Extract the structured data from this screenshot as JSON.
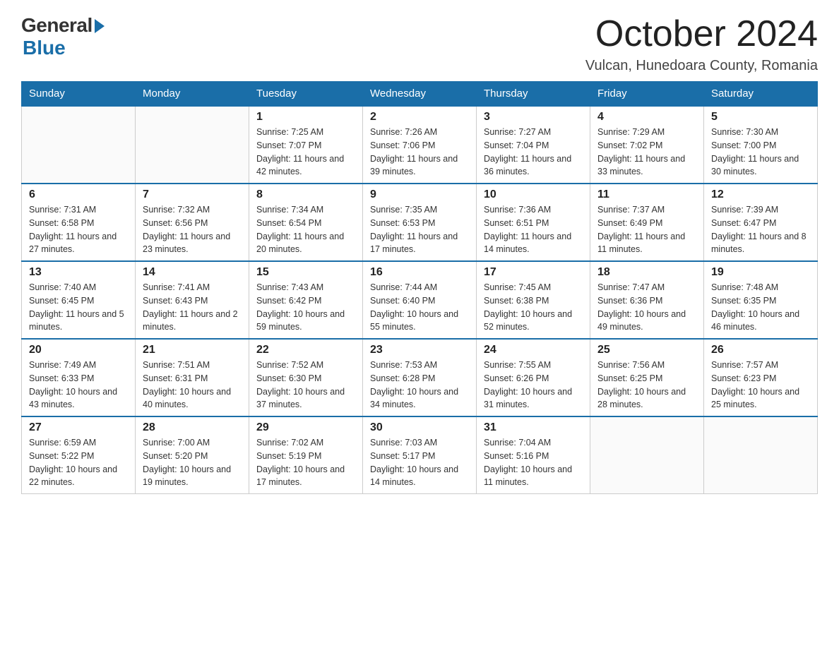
{
  "logo": {
    "general": "General",
    "blue": "Blue"
  },
  "title": "October 2024",
  "location": "Vulcan, Hunedoara County, Romania",
  "days_of_week": [
    "Sunday",
    "Monday",
    "Tuesday",
    "Wednesday",
    "Thursday",
    "Friday",
    "Saturday"
  ],
  "weeks": [
    [
      {
        "day": "",
        "info": ""
      },
      {
        "day": "",
        "info": ""
      },
      {
        "day": "1",
        "info": "Sunrise: 7:25 AM\nSunset: 7:07 PM\nDaylight: 11 hours\nand 42 minutes."
      },
      {
        "day": "2",
        "info": "Sunrise: 7:26 AM\nSunset: 7:06 PM\nDaylight: 11 hours\nand 39 minutes."
      },
      {
        "day": "3",
        "info": "Sunrise: 7:27 AM\nSunset: 7:04 PM\nDaylight: 11 hours\nand 36 minutes."
      },
      {
        "day": "4",
        "info": "Sunrise: 7:29 AM\nSunset: 7:02 PM\nDaylight: 11 hours\nand 33 minutes."
      },
      {
        "day": "5",
        "info": "Sunrise: 7:30 AM\nSunset: 7:00 PM\nDaylight: 11 hours\nand 30 minutes."
      }
    ],
    [
      {
        "day": "6",
        "info": "Sunrise: 7:31 AM\nSunset: 6:58 PM\nDaylight: 11 hours\nand 27 minutes."
      },
      {
        "day": "7",
        "info": "Sunrise: 7:32 AM\nSunset: 6:56 PM\nDaylight: 11 hours\nand 23 minutes."
      },
      {
        "day": "8",
        "info": "Sunrise: 7:34 AM\nSunset: 6:54 PM\nDaylight: 11 hours\nand 20 minutes."
      },
      {
        "day": "9",
        "info": "Sunrise: 7:35 AM\nSunset: 6:53 PM\nDaylight: 11 hours\nand 17 minutes."
      },
      {
        "day": "10",
        "info": "Sunrise: 7:36 AM\nSunset: 6:51 PM\nDaylight: 11 hours\nand 14 minutes."
      },
      {
        "day": "11",
        "info": "Sunrise: 7:37 AM\nSunset: 6:49 PM\nDaylight: 11 hours\nand 11 minutes."
      },
      {
        "day": "12",
        "info": "Sunrise: 7:39 AM\nSunset: 6:47 PM\nDaylight: 11 hours\nand 8 minutes."
      }
    ],
    [
      {
        "day": "13",
        "info": "Sunrise: 7:40 AM\nSunset: 6:45 PM\nDaylight: 11 hours\nand 5 minutes."
      },
      {
        "day": "14",
        "info": "Sunrise: 7:41 AM\nSunset: 6:43 PM\nDaylight: 11 hours\nand 2 minutes."
      },
      {
        "day": "15",
        "info": "Sunrise: 7:43 AM\nSunset: 6:42 PM\nDaylight: 10 hours\nand 59 minutes."
      },
      {
        "day": "16",
        "info": "Sunrise: 7:44 AM\nSunset: 6:40 PM\nDaylight: 10 hours\nand 55 minutes."
      },
      {
        "day": "17",
        "info": "Sunrise: 7:45 AM\nSunset: 6:38 PM\nDaylight: 10 hours\nand 52 minutes."
      },
      {
        "day": "18",
        "info": "Sunrise: 7:47 AM\nSunset: 6:36 PM\nDaylight: 10 hours\nand 49 minutes."
      },
      {
        "day": "19",
        "info": "Sunrise: 7:48 AM\nSunset: 6:35 PM\nDaylight: 10 hours\nand 46 minutes."
      }
    ],
    [
      {
        "day": "20",
        "info": "Sunrise: 7:49 AM\nSunset: 6:33 PM\nDaylight: 10 hours\nand 43 minutes."
      },
      {
        "day": "21",
        "info": "Sunrise: 7:51 AM\nSunset: 6:31 PM\nDaylight: 10 hours\nand 40 minutes."
      },
      {
        "day": "22",
        "info": "Sunrise: 7:52 AM\nSunset: 6:30 PM\nDaylight: 10 hours\nand 37 minutes."
      },
      {
        "day": "23",
        "info": "Sunrise: 7:53 AM\nSunset: 6:28 PM\nDaylight: 10 hours\nand 34 minutes."
      },
      {
        "day": "24",
        "info": "Sunrise: 7:55 AM\nSunset: 6:26 PM\nDaylight: 10 hours\nand 31 minutes."
      },
      {
        "day": "25",
        "info": "Sunrise: 7:56 AM\nSunset: 6:25 PM\nDaylight: 10 hours\nand 28 minutes."
      },
      {
        "day": "26",
        "info": "Sunrise: 7:57 AM\nSunset: 6:23 PM\nDaylight: 10 hours\nand 25 minutes."
      }
    ],
    [
      {
        "day": "27",
        "info": "Sunrise: 6:59 AM\nSunset: 5:22 PM\nDaylight: 10 hours\nand 22 minutes."
      },
      {
        "day": "28",
        "info": "Sunrise: 7:00 AM\nSunset: 5:20 PM\nDaylight: 10 hours\nand 19 minutes."
      },
      {
        "day": "29",
        "info": "Sunrise: 7:02 AM\nSunset: 5:19 PM\nDaylight: 10 hours\nand 17 minutes."
      },
      {
        "day": "30",
        "info": "Sunrise: 7:03 AM\nSunset: 5:17 PM\nDaylight: 10 hours\nand 14 minutes."
      },
      {
        "day": "31",
        "info": "Sunrise: 7:04 AM\nSunset: 5:16 PM\nDaylight: 10 hours\nand 11 minutes."
      },
      {
        "day": "",
        "info": ""
      },
      {
        "day": "",
        "info": ""
      }
    ]
  ]
}
